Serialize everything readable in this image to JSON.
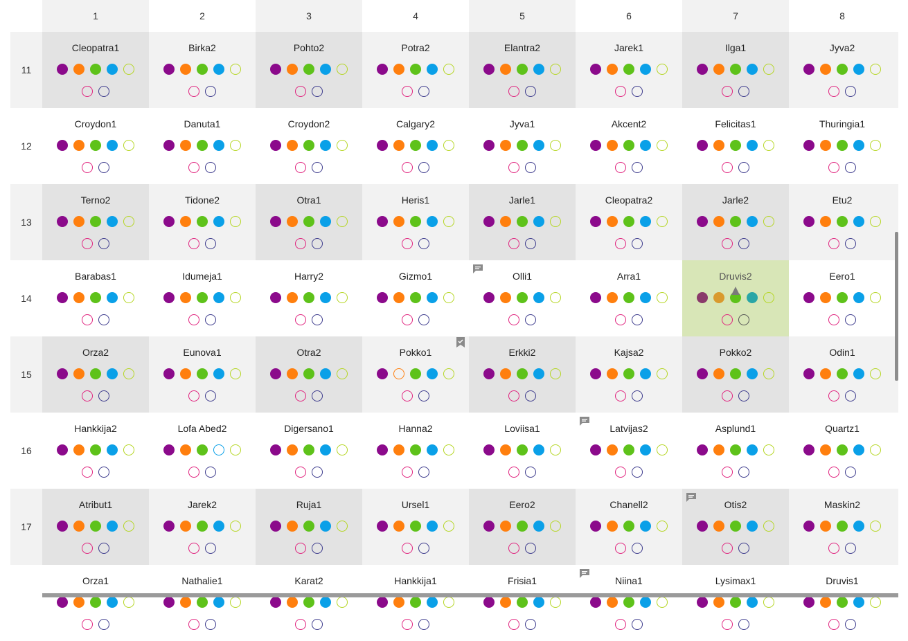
{
  "columns": [
    "1",
    "2",
    "3",
    "4",
    "5",
    "6",
    "7",
    "8"
  ],
  "rows": [
    {
      "label": "11",
      "cells": [
        "Cleopatra1",
        "Birka2",
        "Pohto2",
        "Potra2",
        "Elantra2",
        "Jarek1",
        "Ilga1",
        "Jyva2"
      ]
    },
    {
      "label": "12",
      "cells": [
        "Croydon1",
        "Danuta1",
        "Croydon2",
        "Calgary2",
        "Jyva1",
        "Akcent2",
        "Felicitas1",
        "Thuringia1"
      ]
    },
    {
      "label": "13",
      "cells": [
        "Terno2",
        "Tidone2",
        "Otra1",
        "Heris1",
        "Jarle1",
        "Cleopatra2",
        "Jarle2",
        "Etu2"
      ]
    },
    {
      "label": "14",
      "cells": [
        "Barabas1",
        "Idumeja1",
        "Harry2",
        "Gizmo1",
        "Olli1",
        "Arra1",
        "Druvis2",
        "Eero1"
      ]
    },
    {
      "label": "15",
      "cells": [
        "Orza2",
        "Eunova1",
        "Otra2",
        "Pokko1",
        "Erkki2",
        "Kajsa2",
        "Pokko2",
        "Odin1"
      ]
    },
    {
      "label": "16",
      "cells": [
        "Hankkija2",
        "Lofa Abed2",
        "Digersano1",
        "Hanna2",
        "Loviisa1",
        "Latvijas2",
        "Asplund1",
        "Quartz1"
      ]
    },
    {
      "label": "17",
      "cells": [
        "Atribut1",
        "Jarek2",
        "Ruja1",
        "Ursel1",
        "Eero2",
        "Chanell2",
        "Otis2",
        "Maskin2"
      ]
    },
    {
      "label": "",
      "cells": [
        "Orza1",
        "Nathalie1",
        "Karat2",
        "Hankkija1",
        "Frisia1",
        "Niina1",
        "Lysimax1",
        "Druvis1"
      ]
    }
  ],
  "colors": {
    "purple": "#8b0a8b",
    "orange": "#ff7f0e",
    "green": "#5ec21a",
    "blue": "#0aa0e8",
    "lime": "#b5d623",
    "pink": "#e0237e",
    "navy": "#3c3a8c",
    "shade": "#f2f2f2",
    "shade_dark": "#e3e3e3",
    "highlight": "#d8e6b7",
    "icon": "#8a8a8a"
  },
  "selected_cell": {
    "row": "14",
    "column": "7",
    "name": "Druvis2"
  },
  "comment_icons": [
    {
      "row": "14",
      "column": "5",
      "icon": "comment-icon"
    },
    {
      "row": "16",
      "column": "6",
      "icon": "comment-icon"
    },
    {
      "row": "17",
      "column": "7",
      "icon": "comment-icon"
    },
    {
      "row": "18",
      "column": "6",
      "icon": "comment-icon"
    }
  ],
  "check_icons": [
    {
      "row": "15",
      "column": "4",
      "icon": "bookmark-check-icon"
    }
  ]
}
